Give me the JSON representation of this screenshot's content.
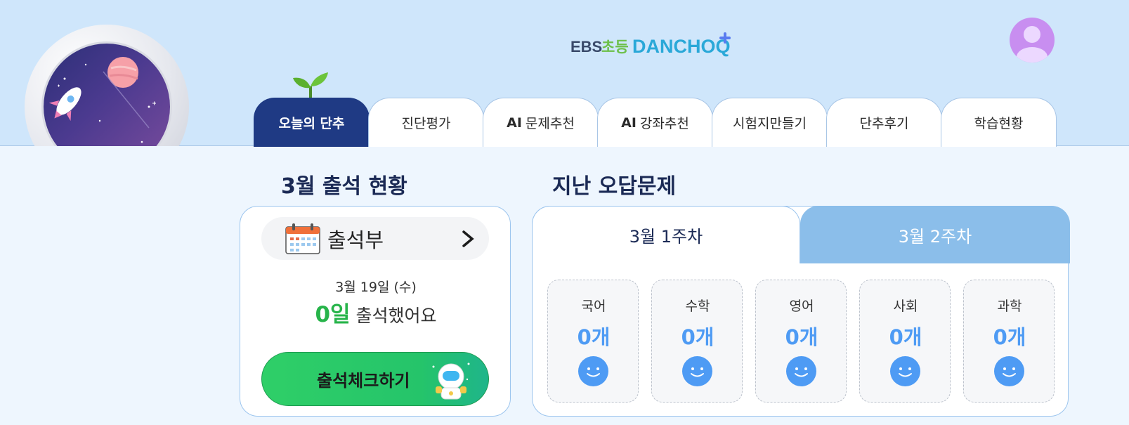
{
  "header": {
    "logo_ebs": "EBS",
    "logo_cho": "초등",
    "logo_brand": "DANCHOQ",
    "tabs": [
      {
        "label": "오늘의 단추",
        "active": true
      },
      {
        "label": "진단평가"
      },
      {
        "prefix": "AI",
        "label": "문제추천"
      },
      {
        "prefix": "AI",
        "label": "강좌추천"
      },
      {
        "label": "시험지만들기"
      },
      {
        "label": "단추후기"
      },
      {
        "label": "학습현황"
      }
    ]
  },
  "attendance": {
    "title": "3월 출석 현황",
    "ledger_label": "출석부",
    "date": "3월 19일 (수)",
    "days": "0일",
    "days_suffix": "출석했어요",
    "check_button": "출석체크하기"
  },
  "wrong_answers": {
    "title": "지난 오답문제",
    "weeks": [
      "3월 1주차",
      "3월 2주차"
    ],
    "subjects": [
      {
        "name": "국어",
        "count": "0개"
      },
      {
        "name": "수학",
        "count": "0개"
      },
      {
        "name": "영어",
        "count": "0개"
      },
      {
        "name": "사회",
        "count": "0개"
      },
      {
        "name": "과학",
        "count": "0개"
      }
    ]
  },
  "colors": {
    "active_tab": "#1f3a84",
    "header_bg": "#cfe6fb",
    "count_blue": "#4e9bf4",
    "green": "#27b44a"
  }
}
